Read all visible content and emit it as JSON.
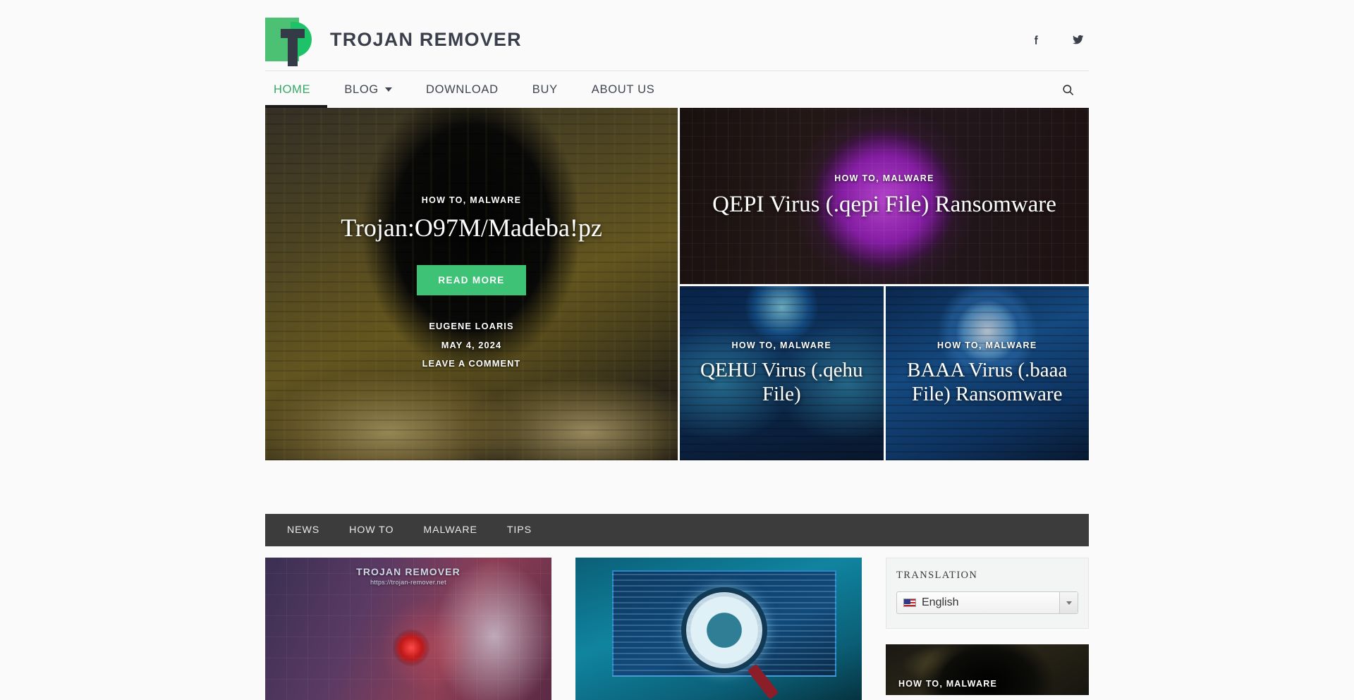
{
  "site": {
    "brand_name": "TROJAN REMOVER",
    "logo_icon": "trojan-remover-logo",
    "accent_green": "#3ec275",
    "nav_active_color": "#35a865",
    "dark_bar": "#3c3c3c"
  },
  "header": {
    "social": [
      {
        "icon": "facebook-icon",
        "label": "f"
      },
      {
        "icon": "twitter-icon",
        "label": "t"
      }
    ]
  },
  "nav": {
    "items": [
      {
        "label": "HOME",
        "active": true,
        "has_caret": false
      },
      {
        "label": "BLOG",
        "active": false,
        "has_caret": true
      },
      {
        "label": "DOWNLOAD",
        "active": false,
        "has_caret": false
      },
      {
        "label": "BUY",
        "active": false,
        "has_caret": false
      },
      {
        "label": "ABOUT US",
        "active": false,
        "has_caret": false
      }
    ],
    "search_icon": "search-icon"
  },
  "hero": {
    "featured": {
      "categories": "HOW TO, MALWARE",
      "title": "Trojan:O97M/Madeba!pz",
      "read_more": "READ MORE",
      "author": "EUGENE LOARIS",
      "date": "MAY 4, 2024",
      "comments": "LEAVE A COMMENT"
    },
    "top_right": {
      "categories": "HOW TO, MALWARE",
      "title": "QEPI Virus (.qepi File) Ransomware"
    },
    "bottom_left": {
      "categories": "HOW TO, MALWARE",
      "title": "QEHU Virus (.qehu File)"
    },
    "bottom_right": {
      "categories": "HOW TO, MALWARE",
      "title": "BAAA Virus (.baaa File) Ransomware"
    }
  },
  "categories": {
    "items": [
      {
        "label": "NEWS"
      },
      {
        "label": "HOW TO"
      },
      {
        "label": "MALWARE"
      },
      {
        "label": "TIPS"
      }
    ]
  },
  "articles": [
    {
      "image_alt": "TROJAN REMOVER",
      "watermark": "TROJAN REMOVER",
      "watermark_url": "https://trojan-remover.net"
    },
    {
      "image_alt": "malware scan magnifier on monitor"
    }
  ],
  "sidebar": {
    "translation": {
      "title": "TRANSLATION",
      "selected_language": "English",
      "flag_icon": "us-flag-icon",
      "dropdown_icon": "chevron-down-icon"
    },
    "promo_card": {
      "categories": "HOW TO, MALWARE"
    }
  }
}
